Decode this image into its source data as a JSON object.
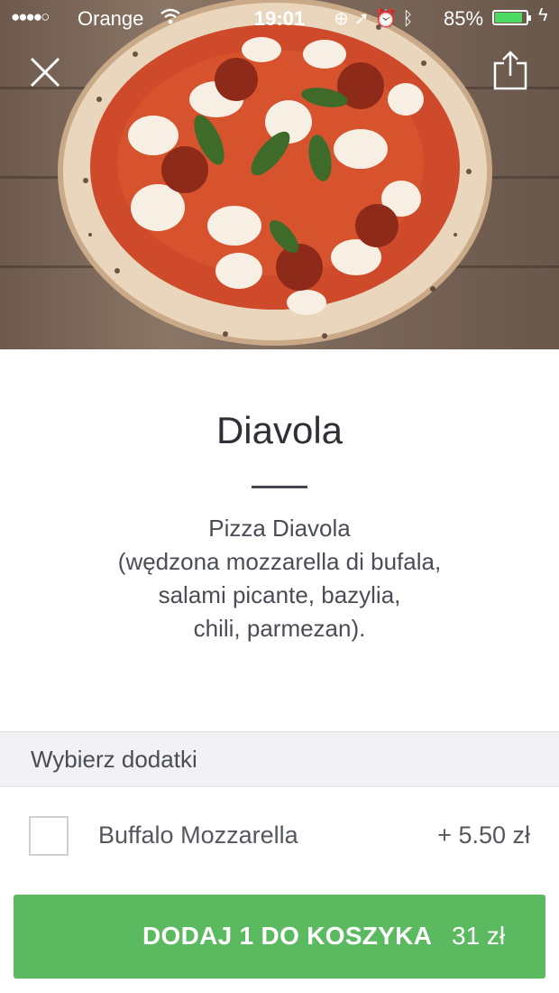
{
  "status_bar": {
    "signal": "●●●●○",
    "carrier": "Orange",
    "time": "19:01",
    "battery_percent": "85%",
    "battery_level": 0.85
  },
  "header": {
    "close_icon": "close-icon",
    "share_icon": "share-icon"
  },
  "product": {
    "title": "Diavola",
    "description_lines": [
      "Pizza Diavola",
      "(wędzona mozzarella di bufala,",
      "salami picante, bazylia,",
      "chili, parmezan)."
    ]
  },
  "extras": {
    "header": "Wybierz dodatki",
    "items": [
      {
        "label": "Buffalo Mozzarella",
        "price": "+ 5.50 zł",
        "checked": false
      }
    ]
  },
  "cart_button": {
    "label": "DODAJ 1 DO KOSZYKA",
    "price": "31 zł"
  },
  "colors": {
    "accent_green": "#5bb95f",
    "battery_green": "#4cd964",
    "text_dark": "#2f3037"
  }
}
